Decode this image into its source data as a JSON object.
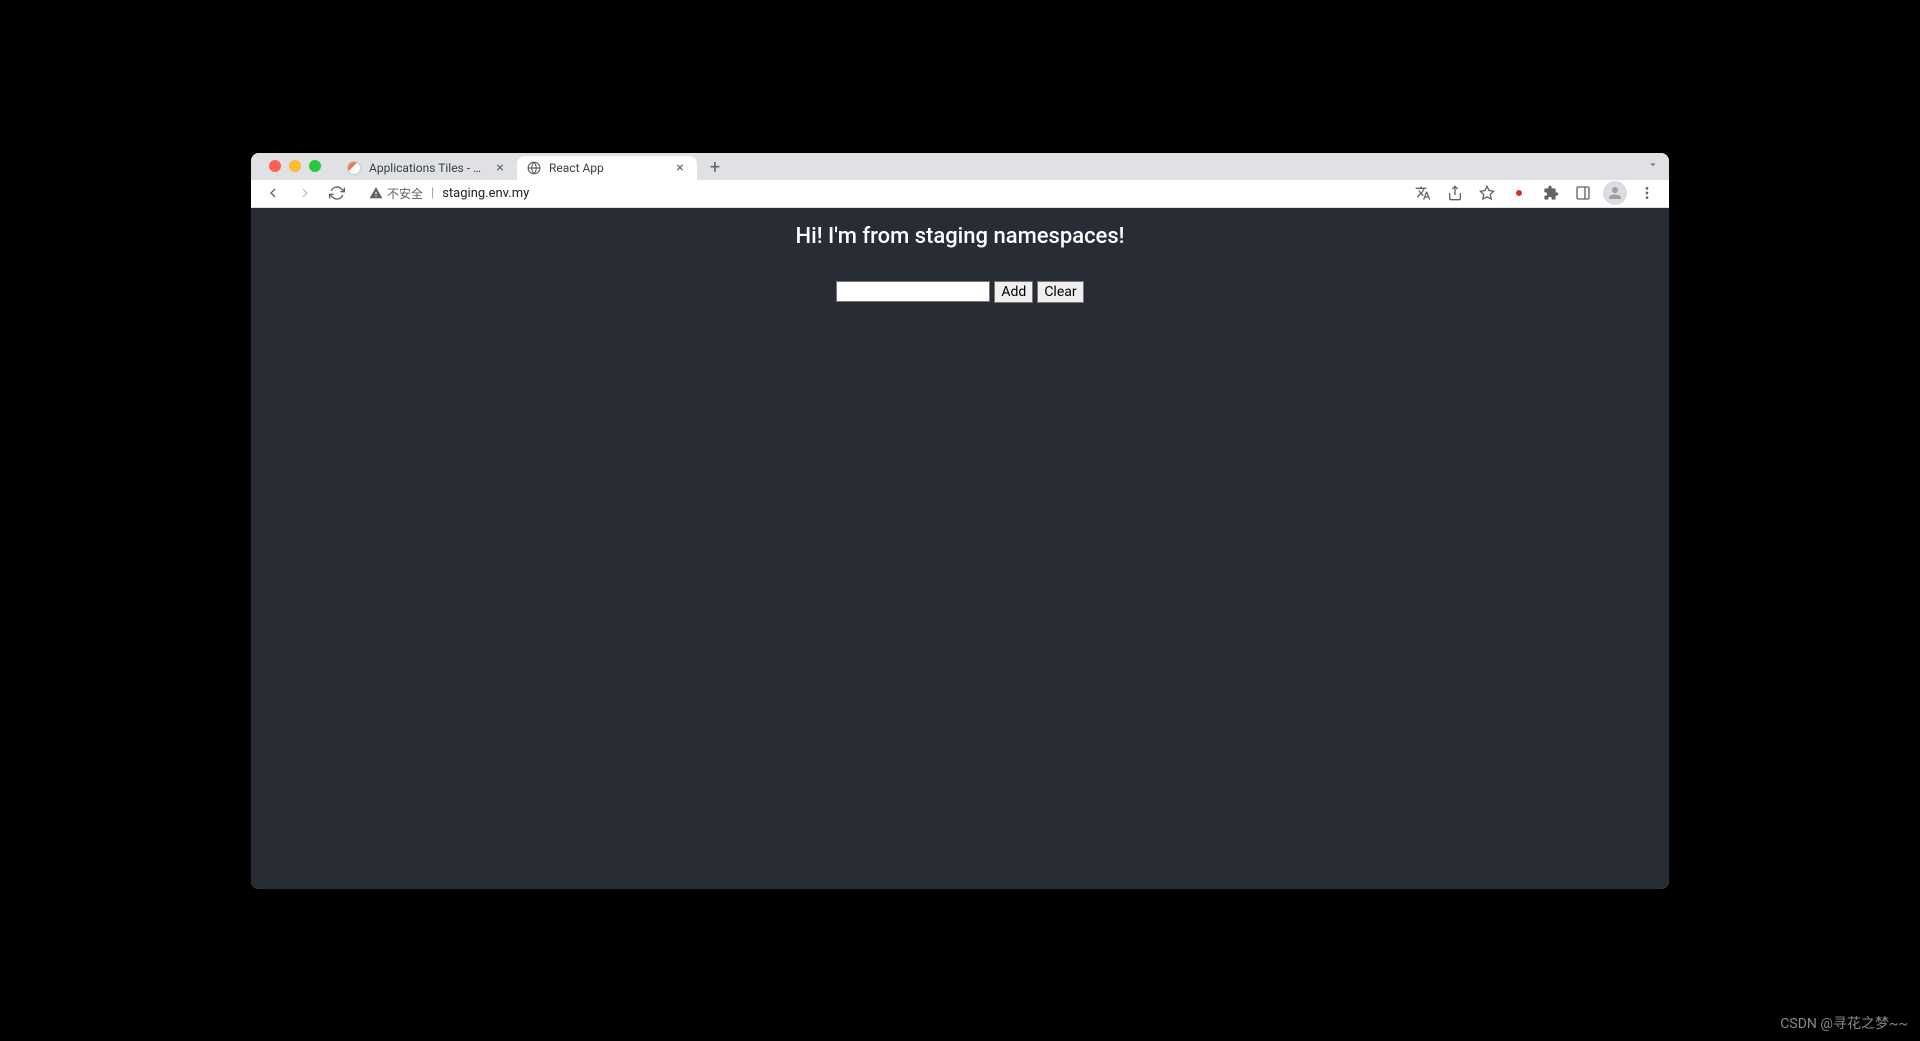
{
  "browser": {
    "tabs": [
      {
        "title": "Applications Tiles - Argo CD",
        "favicon": "argo"
      },
      {
        "title": "React App",
        "favicon": "globe"
      }
    ],
    "address": {
      "securityLabel": "不安全",
      "url": "staging.env.my"
    }
  },
  "page": {
    "heading": "Hi! I'm from staging namespaces!",
    "input_value": "",
    "buttons": {
      "add": "Add",
      "clear": "Clear"
    }
  },
  "watermark": "CSDN @寻花之梦~~"
}
